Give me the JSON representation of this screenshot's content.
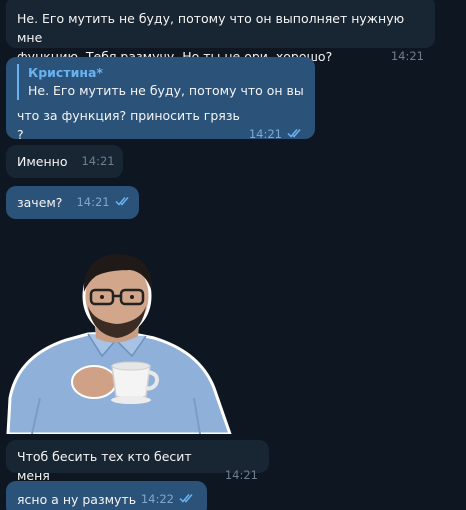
{
  "messages": [
    {
      "text_line1": "Не. Его мутить не буду, потому что он выполняет нужную мне",
      "text_line2": "функцию. Тебя размучу. Но ты не ори, хорошо?",
      "time": "14:21"
    },
    {
      "quote_author": "Кристина*",
      "quote_text": "Не. Его мутить не буду, потому что он вы...",
      "text": "что за функция? приносить грязь ?",
      "time": "14:21"
    },
    {
      "text": "Именно",
      "time": "14:21"
    },
    {
      "text": "зачем?",
      "time": "14:21"
    },
    {
      "text": "Чтоб бесить тех кто бесит меня",
      "time": "14:21"
    },
    {
      "text": "ясно а ну размуть",
      "time": "14:22"
    }
  ],
  "colors": {
    "background": "#0e1621",
    "incoming_bubble": "#182533",
    "outgoing_bubble": "#2b5278",
    "accent": "#6ab3f3"
  },
  "sticker": {
    "icon": "man-with-coffee-cup-sticker"
  }
}
